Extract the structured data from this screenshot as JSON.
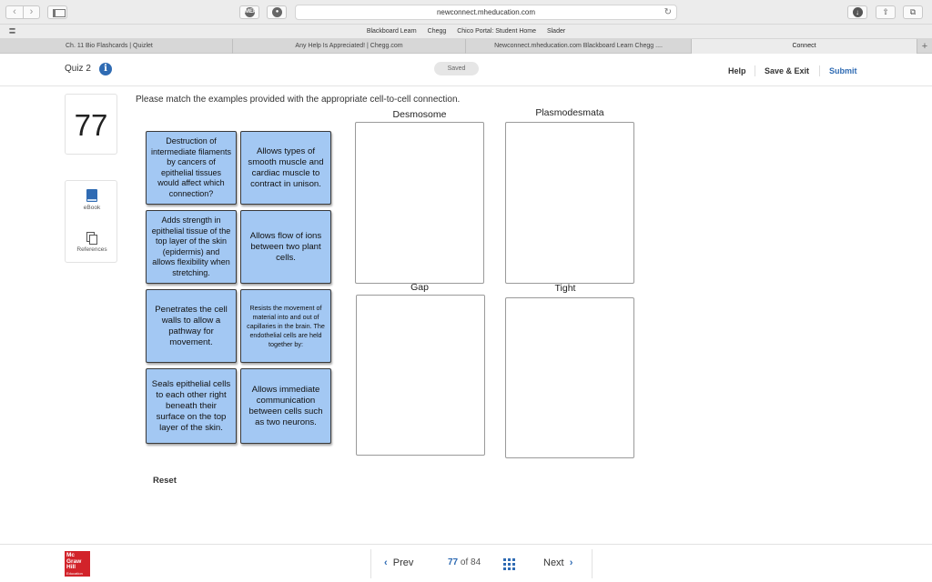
{
  "browser": {
    "url": "newconnect.mheducation.com",
    "favorites": [
      "Blackboard Learn",
      "Chegg",
      "Chico Portal: Student Home",
      "Slader"
    ],
    "tabs": [
      "Ch. 11 Bio Flashcards | Quizlet",
      "Any Help Is Appreciated! | Chegg.com",
      "Newconnect.mheducation.com Blackboard Learn Chegg ....",
      "Connect"
    ],
    "new_tab": "+",
    "extension_label": "MEP",
    "icons": [
      "back-icon",
      "forward-icon",
      "sidebar-icon",
      "reload-icon",
      "download-icon",
      "share-icon",
      "tabs-icon"
    ]
  },
  "header": {
    "quiz_title": "Quiz 2",
    "info": "i",
    "status": "Saved",
    "help": "Help",
    "save_exit": "Save & Exit",
    "submit": "Submit"
  },
  "rail": {
    "question_number": "77",
    "ebook": "eBook",
    "references": "References"
  },
  "question": {
    "instructions": "Please match the examples provided with the appropriate cell-to-cell connection.",
    "cards": [
      "Destruction of intermediate filaments by cancers of epithelial tissues would affect which connection?",
      "Allows types of smooth muscle and cardiac muscle to contract in unison.",
      "Adds strength in epithelial tissue of the top layer of the skin (epidermis) and allows flexibility when stretching.",
      "Allows flow of ions between two plant cells.",
      "Penetrates the cell walls to allow a pathway for movement.",
      "Resists the movement of material into and out of capillaries in the brain. The endothelial cells are held together by:",
      "Seals epithelial cells to each other right beneath their surface on the top layer of the skin.",
      "Allows immediate communication between cells such as two neurons."
    ],
    "zones": [
      "Desmosome",
      "Plasmodesmata",
      "Gap",
      "Tight"
    ],
    "reset": "Reset"
  },
  "footer": {
    "logo": [
      "Mc",
      "Graw",
      "Hill",
      "Education"
    ],
    "prev": "Prev",
    "current": "77",
    "of_label": "of",
    "total": "84",
    "next": "Next"
  },
  "colors": {
    "card_fill": "#a3c8f3",
    "accent_blue": "#2f6bb3",
    "brand_red": "#d2232a"
  }
}
